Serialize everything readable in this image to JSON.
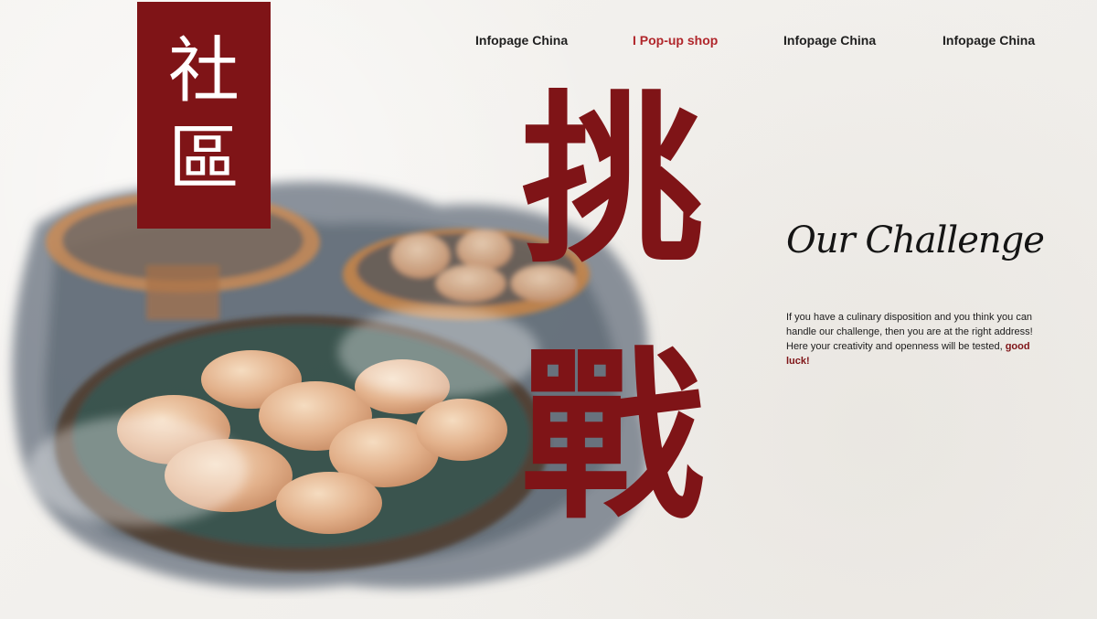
{
  "logo": {
    "char_top": "社",
    "char_bottom": "區"
  },
  "nav": {
    "items": [
      {
        "label": "Infopage China"
      },
      {
        "label": "I Pop-up shop"
      },
      {
        "label": "Infopage China"
      },
      {
        "label": "Infopage China"
      }
    ]
  },
  "hero": {
    "kanji_top": "挑",
    "kanji_bottom": "戰"
  },
  "challenge": {
    "title": "Our Challenge",
    "body": "If you have a culinary disposition and you think you can handle our challenge, then you are at the right address! Here your creativity and openness will be tested,",
    "highlight": "good luck!"
  },
  "colors": {
    "brand": "#7f1417",
    "active_link": "#b0262b",
    "background": "#f3f1ee"
  },
  "icons": {
    "hero_image": "steamed-dumplings-watercolor-image"
  }
}
